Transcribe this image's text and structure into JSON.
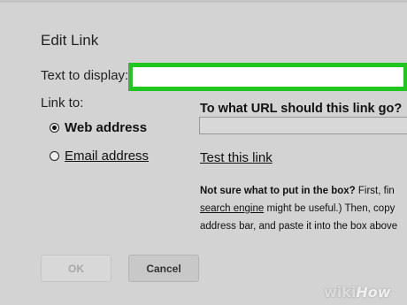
{
  "dialog": {
    "title": "Edit Link",
    "text_to_display_label": "Text to display:",
    "text_to_display_value": "",
    "link_to_label": "Link to:",
    "options": [
      {
        "label": "Web address",
        "selected": true
      },
      {
        "label": "Email address",
        "selected": false
      }
    ],
    "url_heading": "To what URL should this link go?",
    "url_value": "",
    "test_link": "Test this link",
    "help": {
      "bold": "Not sure what to put in the box?",
      "line1_rest": " First, fin",
      "link": "search engine",
      "line2_rest": " might be useful.) Then, copy",
      "line3": "address bar, and paste it into the box above"
    },
    "buttons": {
      "ok": "OK",
      "cancel": "Cancel"
    }
  },
  "watermark": {
    "part1": "wiki",
    "part2": "How"
  },
  "colors": {
    "highlight": "#1ec61e",
    "background": "#d3d3d3"
  }
}
